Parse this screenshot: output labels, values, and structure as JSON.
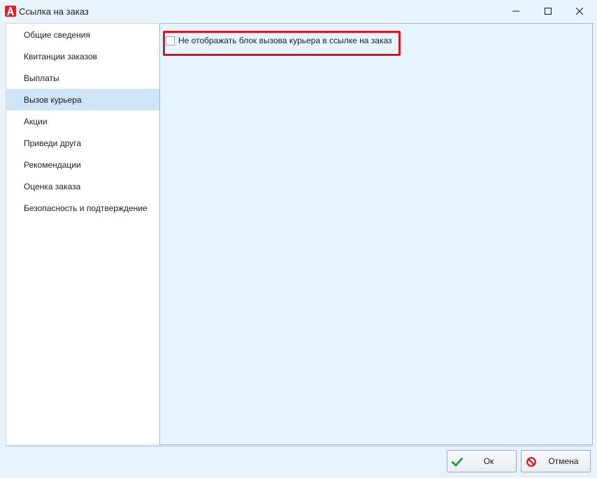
{
  "window": {
    "title": "Ссылка на заказ",
    "icon": "app-logo-icon",
    "controls": [
      "minimize-icon",
      "maximize-icon",
      "close-icon"
    ]
  },
  "sidebar": {
    "items": [
      {
        "label": "Общие сведения",
        "active": false
      },
      {
        "label": "Квитанции заказов",
        "active": false
      },
      {
        "label": "Выплаты",
        "active": false
      },
      {
        "label": "Вызов курьера",
        "active": true
      },
      {
        "label": "Акции",
        "active": false
      },
      {
        "label": "Приведи друга",
        "active": false
      },
      {
        "label": "Рекомендации",
        "active": false
      },
      {
        "label": "Оценка заказа",
        "active": false
      },
      {
        "label": "Безопасность и подтверждение",
        "active": false
      }
    ]
  },
  "content": {
    "hide_courier_checkbox": {
      "label": "Не отображать блок вызова курьера в ссылке на заказ",
      "checked": false
    }
  },
  "footer": {
    "ok_label": "Ок",
    "ok_icon": "checkmark-icon",
    "cancel_label": "Отмена",
    "cancel_icon": "no-entry-icon"
  },
  "colors": {
    "accent_highlight": "#e0141e",
    "active_item_bg": "#cde5f7",
    "ok_icon": "#2a9c3f",
    "cancel_icon": "#d4141c"
  }
}
